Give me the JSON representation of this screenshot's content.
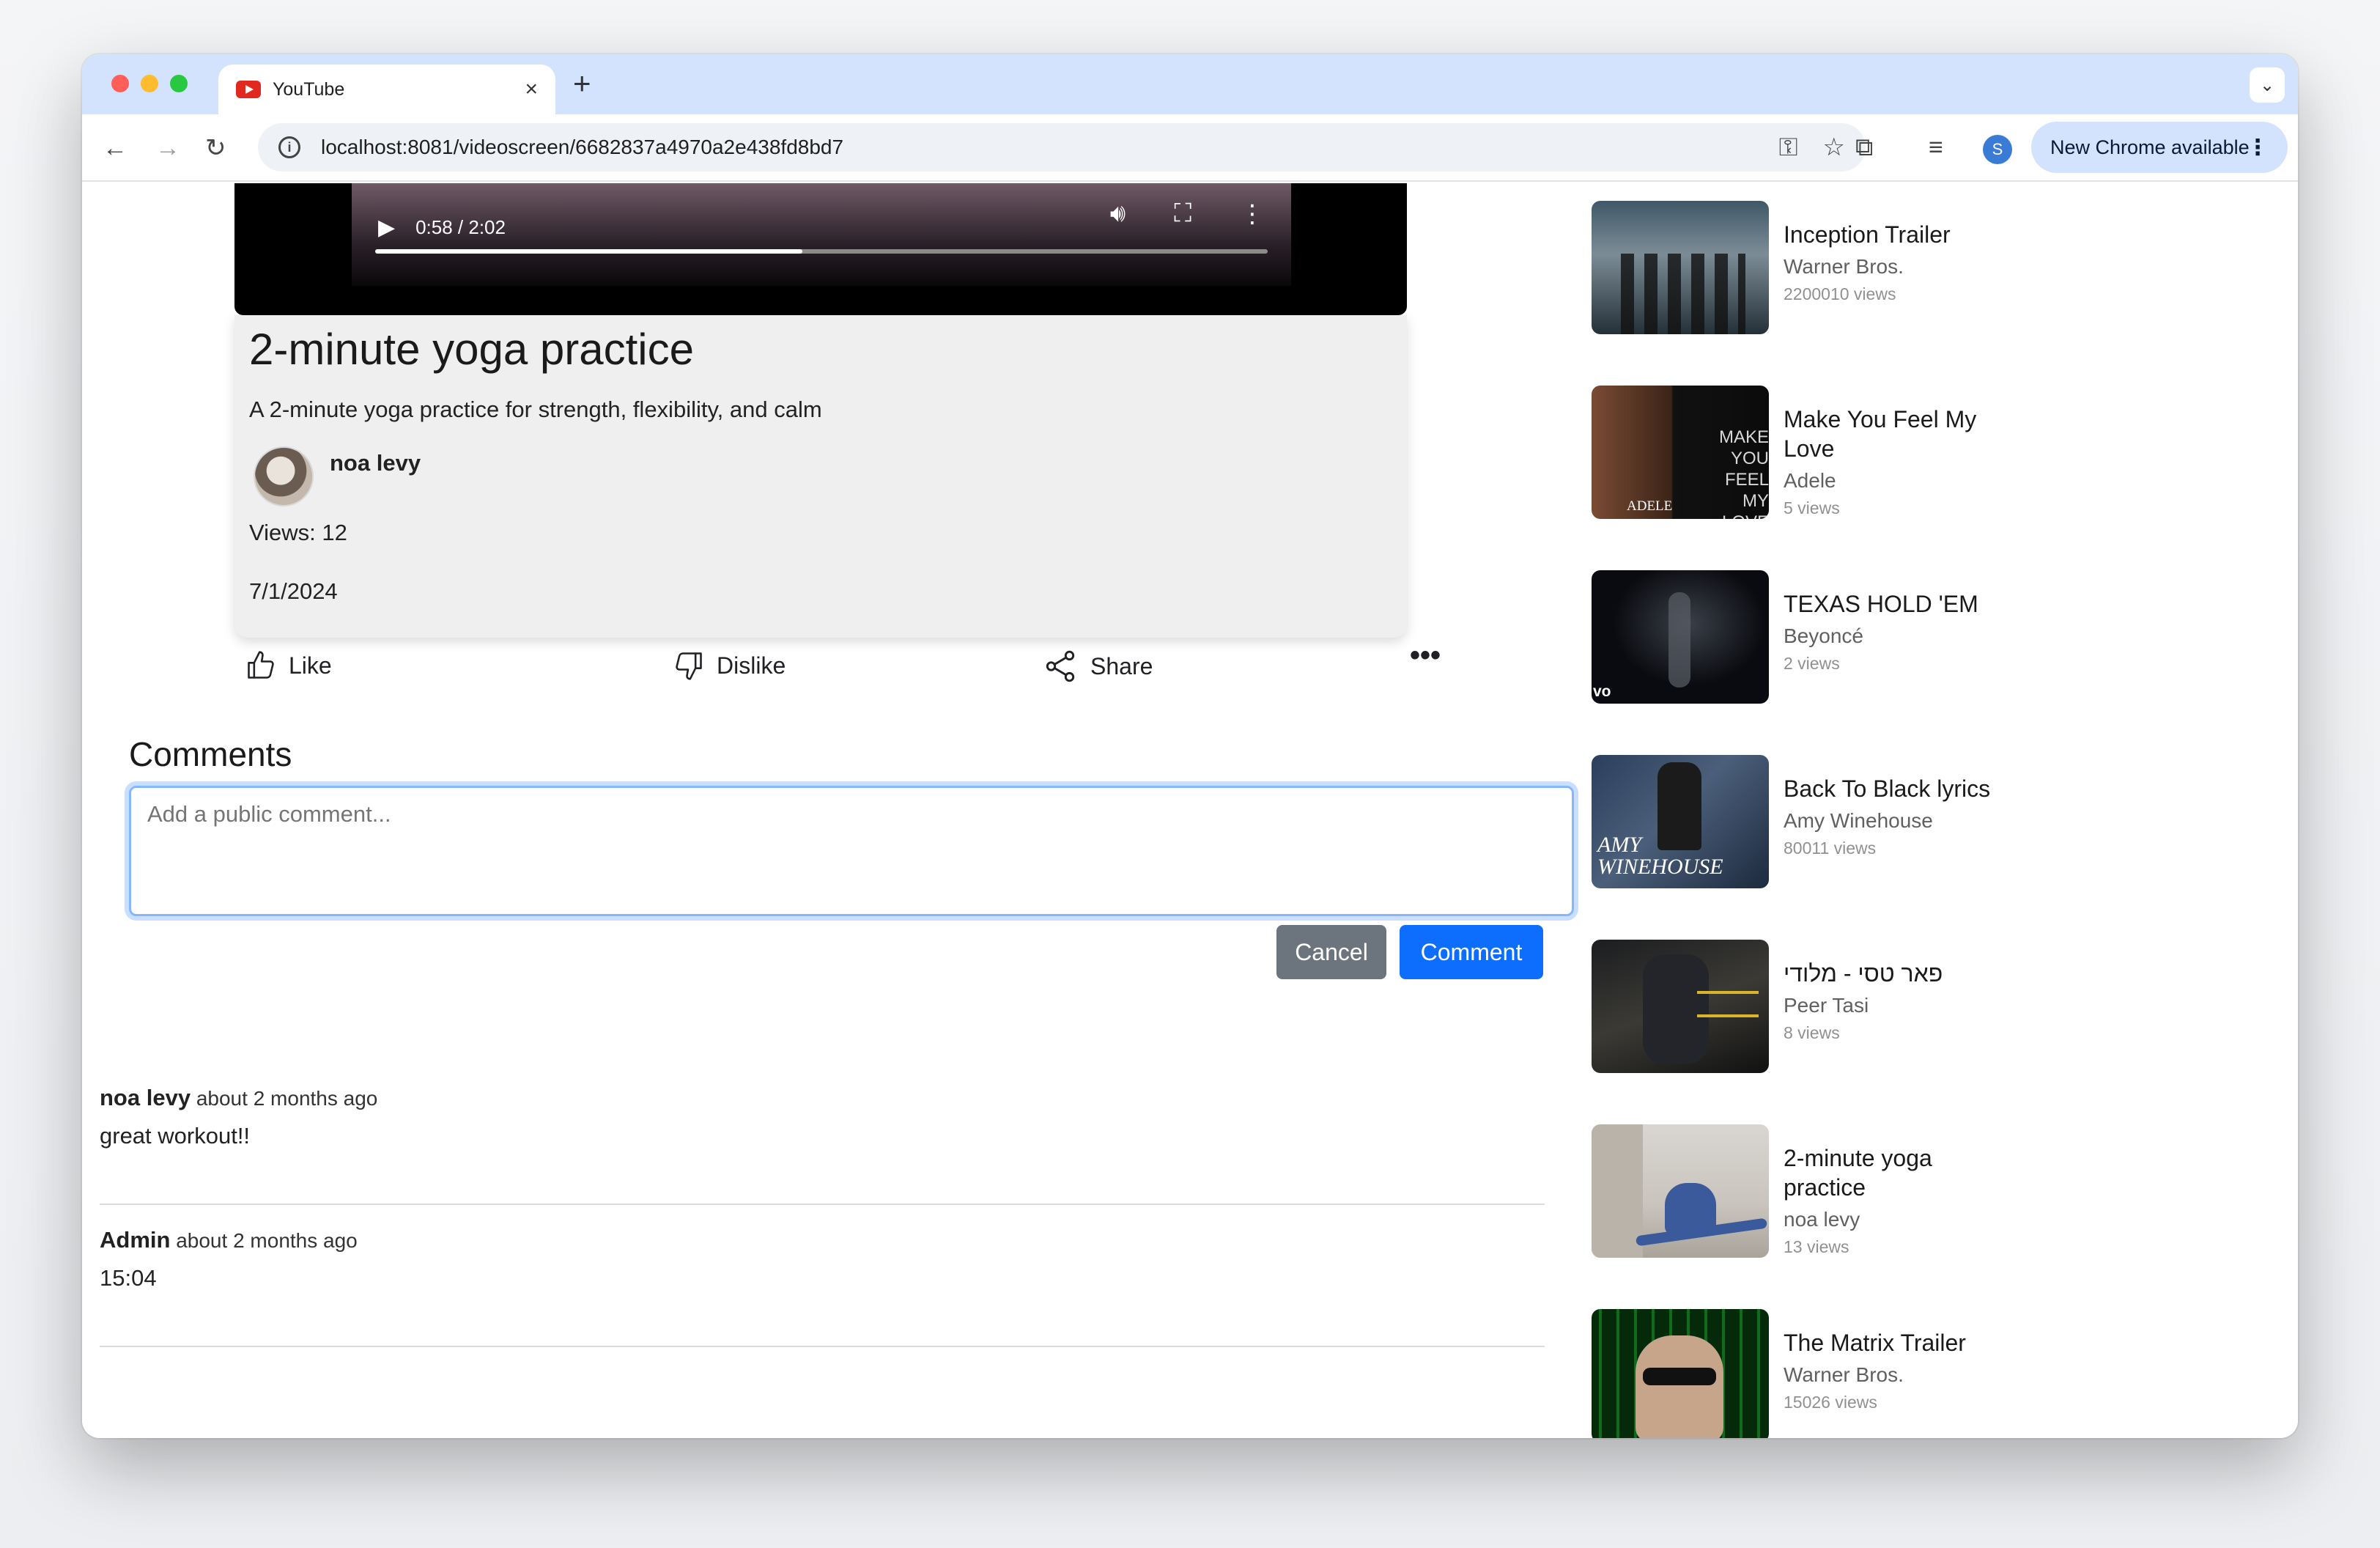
{
  "browser": {
    "tab_title": "YouTube",
    "new_tab": "+",
    "url": "localhost:8081/videoscreen/6682837a4970a2e438fd8bd7",
    "profile_initial": "S",
    "update_label": "New Chrome available"
  },
  "player": {
    "time": "0:58 / 2:02",
    "progress_fraction": 0.4787
  },
  "video": {
    "title": "2-minute yoga practice",
    "description": "A 2-minute yoga practice for strength, flexibility, and calm",
    "uploader": "noa levy",
    "views": "Views: 12",
    "date": "7/1/2024"
  },
  "actions": {
    "like": "Like",
    "dislike": "Dislike",
    "share": "Share"
  },
  "comments": {
    "heading": "Comments",
    "placeholder": "Add a public comment...",
    "cancel": "Cancel",
    "submit": "Comment",
    "items": [
      {
        "author": "noa levy",
        "time": "about 2 months ago",
        "text": "great workout!!"
      },
      {
        "author": "Admin",
        "time": "about 2 months ago",
        "text": "15:04"
      }
    ]
  },
  "sidebar": {
    "items": [
      {
        "title": "Inception Trailer",
        "channel": "Warner Bros.",
        "views": "2200010 views"
      },
      {
        "title": "Make You Feel My Love",
        "channel": "Adele",
        "views": "5 views",
        "thumb_text": "MAKE YOU FEEL MY LOVE",
        "thumb_brand": "ADELE"
      },
      {
        "title": "TEXAS HOLD 'EM",
        "channel": "Beyoncé",
        "views": "2 views",
        "thumb_text": "vo"
      },
      {
        "title": "Back To Black lyrics",
        "channel": "Amy Winehouse",
        "views": "80011 views",
        "thumb_text": "AMY WINEHOUSE"
      },
      {
        "title": "פאר טסי - מלודי",
        "channel": "Peer Tasi",
        "views": "8 views"
      },
      {
        "title": "2-minute yoga practice",
        "channel": "noa levy",
        "views": "13 views"
      },
      {
        "title": "The Matrix Trailer",
        "channel": "Warner Bros.",
        "views": "15026 views"
      }
    ]
  },
  "colors": {
    "accent": "#0d6efd",
    "cancel": "#6c757d",
    "tabstrip": "#d3e3fd"
  }
}
